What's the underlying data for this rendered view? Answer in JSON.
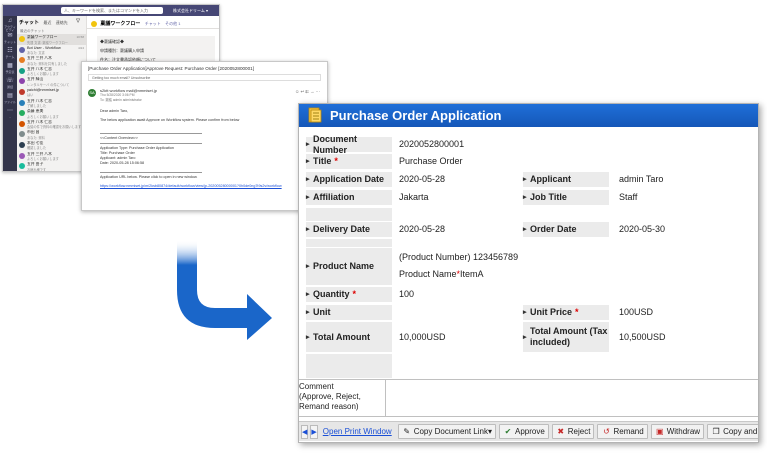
{
  "teams": {
    "search_placeholder": "人、キーワードを検索、またはコマンドを入力",
    "org": "株式会社ドリーム ▾",
    "rail": [
      {
        "icon": "activity-icon",
        "label": "アクティビティ"
      },
      {
        "icon": "chat-icon",
        "label": "チャット"
      },
      {
        "icon": "teams-icon",
        "label": "チーム"
      },
      {
        "icon": "calendar-icon",
        "label": "予定表"
      },
      {
        "icon": "calls-icon",
        "label": "通話"
      },
      {
        "icon": "files-icon",
        "label": "ファイル"
      },
      {
        "icon": "more-icon",
        "label": "..."
      }
    ],
    "chat_header": "チャット",
    "chat_tabs": [
      "最近",
      "連絡先"
    ],
    "recent_label": "最近のチャット",
    "chats": [
      {
        "name": "稟議ワークフロー",
        "preview": "先週 文書: 稟議ワークフロー",
        "time": "10:58",
        "color": "#f1c40f"
      },
      {
        "name": "Bot User - Workflow",
        "preview": "あなた: 文書",
        "time": "4/24",
        "color": "#6264a7"
      },
      {
        "name": "五井 三井 八木",
        "preview": "あなた: 資料を共有しました",
        "time": "",
        "color": "#e67e22"
      },
      {
        "name": "五井 八木 仁志",
        "preview": "よろしくお願いします",
        "time": "",
        "color": "#16a085"
      },
      {
        "name": "五井 緑山",
        "preview": "レンタルサーバ の件について",
        "time": "",
        "color": "#8e44ad"
      },
      {
        "name": "yaichi@nmmiset.jp",
        "preview": "はい",
        "time": "",
        "color": "#c0392b"
      },
      {
        "name": "五井 八木 仁志",
        "preview": "了解しました",
        "time": "",
        "color": "#2980b9"
      },
      {
        "name": "斎藤 恵美",
        "preview": "よろしくお願いします",
        "time": "",
        "color": "#27ae60"
      },
      {
        "name": "五井 八木 仁志",
        "preview": "会議の件で資料の確認をお願いします",
        "time": "",
        "color": "#d35400"
      },
      {
        "name": "市田 昌",
        "preview": "あなた: 資料",
        "time": "",
        "color": "#7f8c8d"
      },
      {
        "name": "本田 七佳",
        "preview": "確認しました",
        "time": "",
        "color": "#2c3e50"
      },
      {
        "name": "五井 三井 八木",
        "preview": "よろしくお願いします",
        "time": "",
        "color": "#9b59b6"
      },
      {
        "name": "五井 由子",
        "preview": "お疲れ様です",
        "time": "",
        "color": "#1abc9c"
      },
      {
        "name": "廣田 健夫",
        "preview": "あなた: 資料",
        "time": "",
        "color": "#e74c3c"
      }
    ],
    "conv_title": "稟議ワークフロー",
    "conv_tabs": [
      "チャット",
      "その他 1"
    ],
    "conv_lines": [
      "◆稟議確認◆",
      "申請種別：稟議購入申請",
      "件名：注文書承認依頼について"
    ]
  },
  "mail": {
    "subject": "[Purchase Order Application]Approve Request: Purchase Order [2020052800001]",
    "hint": "Getting too much email? Unsubscribe",
    "avatar": "SA",
    "sender": "s2ktt workflow mail@nmmiset.jp",
    "date": "Thu 5/28/2020 3:06 PM",
    "to": "To: 稟議 admin administrator",
    "lines_before": [
      "Dear admin Taro,",
      "",
      "The below application await Approve on Workflow system. Please confirm from below"
    ],
    "overview_label": "<<Content Overview>>",
    "overview_lines": [
      "Application Type: Purchase Order Application",
      "Title: Purchase Order",
      "Applicant: admin Taro",
      "Date: 2020-05-28 15:06:58"
    ],
    "url_text": "Application URL below. Please click to open in new window.",
    "link": "https://workflow.nmmiset.jp/m/2ksb80874/default/workflow/view/jp-20200528000001?0h0de0ng7t9s2v/workflow"
  },
  "po": {
    "title": "Purchase Order Application",
    "fields": {
      "document_number": {
        "label": "Document Number",
        "value": "2020052800001"
      },
      "title": {
        "label": "Title",
        "value": "Purchase Order"
      },
      "application_date": {
        "label": "Application Date",
        "value": "2020-05-28"
      },
      "applicant": {
        "label": "Applicant",
        "value": "admin Taro"
      },
      "affiliation": {
        "label": "Affiliation",
        "value": "Jakarta"
      },
      "job_title": {
        "label": "Job Title",
        "value": "Staff"
      },
      "delivery_date": {
        "label": "Delivery Date",
        "value": "2020-05-28"
      },
      "order_date": {
        "label": "Order Date",
        "value": "2020-05-30"
      },
      "product_name": {
        "label": "Product Name",
        "value_line1": "(Product Number) 123456789",
        "value_line2_label": "Product Name ",
        "value_line2_value": "ItemA"
      },
      "quantity": {
        "label": "Quantity",
        "value": "100"
      },
      "unit": {
        "label": "Unit",
        "value": ""
      },
      "unit_price": {
        "label": "Unit Price",
        "value": "100USD"
      },
      "total_amount": {
        "label": "Total Amount",
        "value": "10,000USD"
      },
      "total_amount_tax": {
        "label": "Total Amount (Tax included)",
        "value": "10,500USD"
      }
    },
    "required_mark": "*",
    "comment_label": "Comment\n(Approve, Reject,\nRemand reason)",
    "toolbar": {
      "prev": "◀",
      "next": "▶",
      "open_print": "Open Print Window",
      "copy_link": "Copy Document Link▾",
      "approve": "Approve",
      "reject": "Reject",
      "remand": "Remand",
      "withdraw": "Withdraw",
      "copy_create": "Copy and Create new"
    }
  },
  "colors": {
    "title_blue": "#1557b8",
    "label_gray": "#ebebeb",
    "required_red": "#dd0000",
    "arrow_blue": "#1a66c9"
  }
}
